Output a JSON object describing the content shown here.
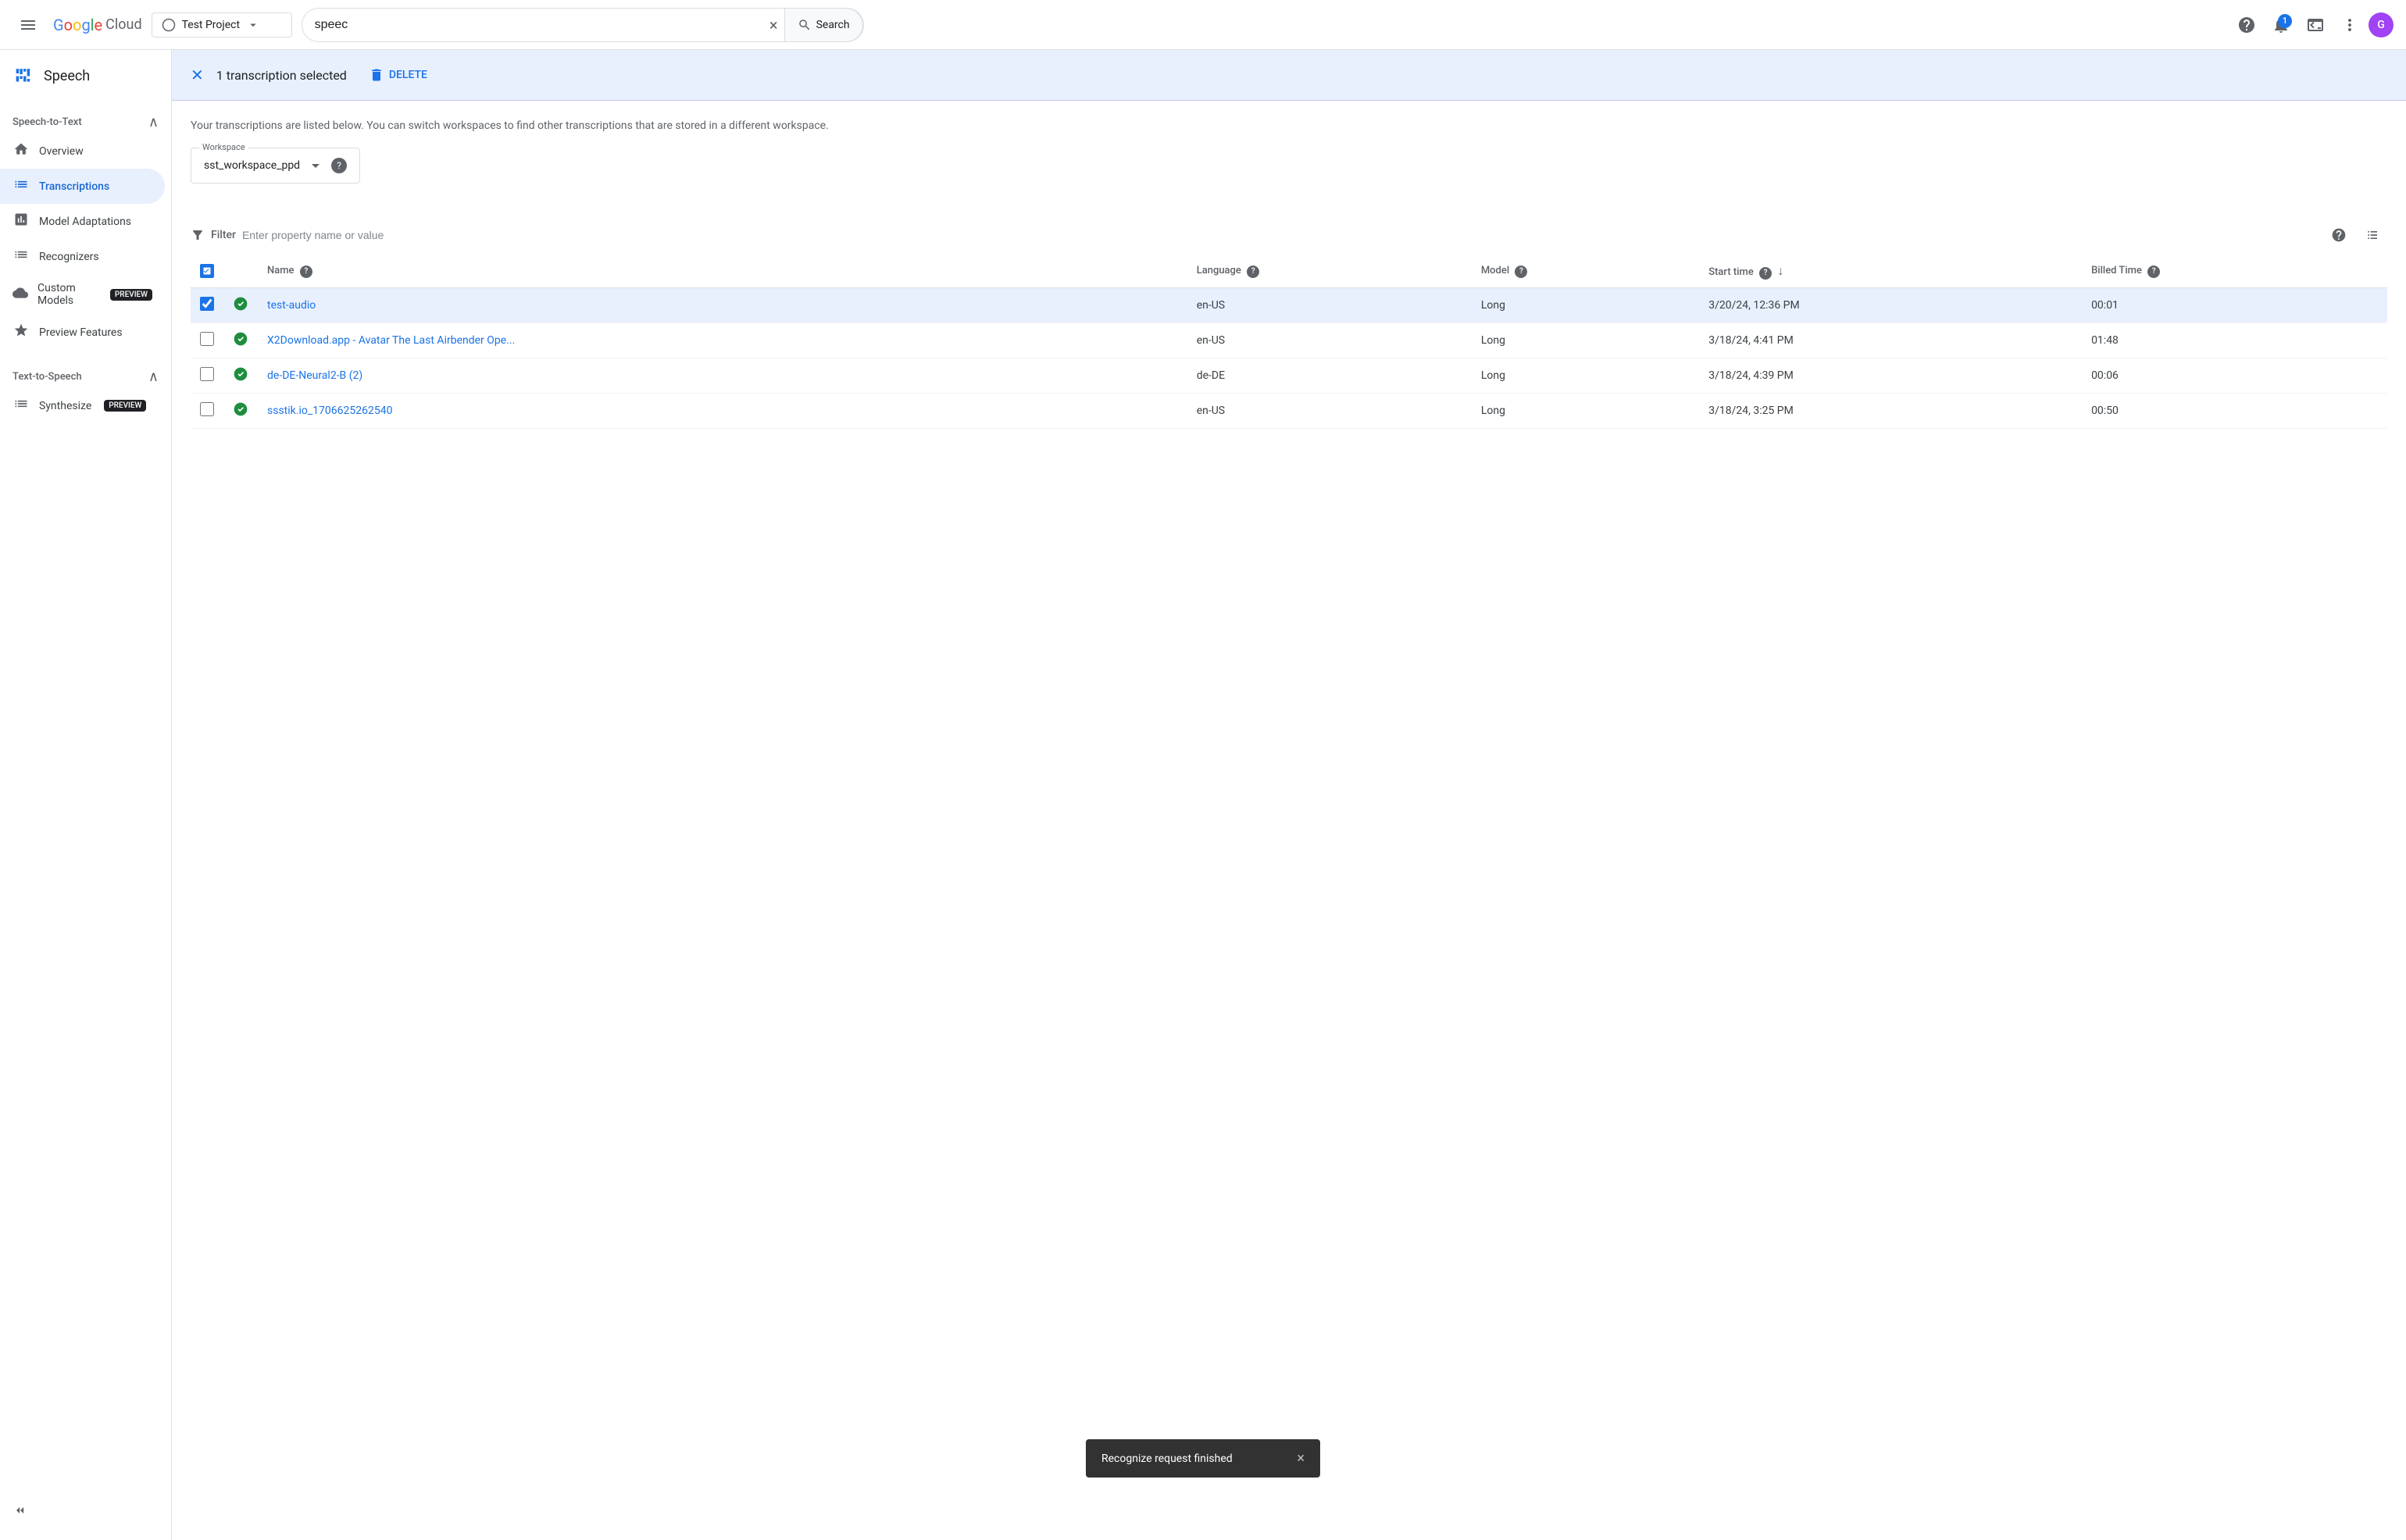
{
  "topbar": {
    "menu_icon": "≡",
    "logo": {
      "google": "Google",
      "cloud": "Cloud"
    },
    "project": {
      "name": "Test Project",
      "icon": "▼"
    },
    "search": {
      "value": "speec",
      "placeholder": "Search",
      "clear_icon": "×",
      "button_label": "Search"
    },
    "actions": {
      "notifications_icon": "🔔",
      "cloud_shell_icon": "⌨",
      "notification_count": "1",
      "more_icon": "⋮",
      "avatar_label": "G"
    }
  },
  "sidebar": {
    "app_title": "Speech",
    "app_icon": "📊",
    "section_stt": "Speech-to-Text",
    "items": [
      {
        "id": "overview",
        "label": "Overview",
        "icon": "⌂"
      },
      {
        "id": "transcriptions",
        "label": "Transcriptions",
        "icon": "☰",
        "active": true
      },
      {
        "id": "model-adaptations",
        "label": "Model Adaptations",
        "icon": "📊"
      },
      {
        "id": "recognizers",
        "label": "Recognizers",
        "icon": "☰"
      },
      {
        "id": "custom-models",
        "label": "Custom Models",
        "icon": "☁",
        "badge": "PREVIEW"
      },
      {
        "id": "preview-features",
        "label": "Preview Features",
        "icon": "★"
      }
    ],
    "section_tts": "Text-to-Speech",
    "tts_items": [
      {
        "id": "synthesize",
        "label": "Synthesize",
        "icon": "☰",
        "badge": "PREVIEW"
      }
    ],
    "collapse_label": "◁"
  },
  "selection_bar": {
    "count_text": "1 transcription selected",
    "delete_label": "DELETE"
  },
  "page": {
    "description": "Your transcriptions are listed below. You can switch workspaces to find other transcriptions that are stored in a different workspace.",
    "workspace": {
      "label": "Workspace",
      "value": "sst_workspace_ppd"
    },
    "filter": {
      "label": "Filter",
      "placeholder": "Enter property name or value"
    },
    "table": {
      "columns": [
        {
          "id": "name",
          "label": "Name",
          "has_help": true
        },
        {
          "id": "language",
          "label": "Language",
          "has_help": true
        },
        {
          "id": "model",
          "label": "Model",
          "has_help": true
        },
        {
          "id": "start_time",
          "label": "Start time",
          "has_help": true,
          "sortable": true
        },
        {
          "id": "billed_time",
          "label": "Billed Time",
          "has_help": true
        }
      ],
      "rows": [
        {
          "id": 1,
          "selected": true,
          "status": "success",
          "name": "test-audio",
          "language": "en-US",
          "model": "Long",
          "start_time": "3/20/24, 12:36 PM",
          "billed_time": "00:01"
        },
        {
          "id": 2,
          "selected": false,
          "status": "success",
          "name": "X2Download.app - Avatar The Last Airbender Ope...",
          "language": "en-US",
          "model": "Long",
          "start_time": "3/18/24, 4:41 PM",
          "billed_time": "01:48"
        },
        {
          "id": 3,
          "selected": false,
          "status": "success",
          "name": "de-DE-Neural2-B (2)",
          "language": "de-DE",
          "model": "Long",
          "start_time": "3/18/24, 4:39 PM",
          "billed_time": "00:06"
        },
        {
          "id": 4,
          "selected": false,
          "status": "success",
          "name": "ssstik.io_1706625262540",
          "language": "en-US",
          "model": "Long",
          "start_time": "3/18/24, 3:25 PM",
          "billed_time": "00:50"
        }
      ]
    }
  },
  "snackbar": {
    "message": "Recognize request finished",
    "close_icon": "×"
  }
}
